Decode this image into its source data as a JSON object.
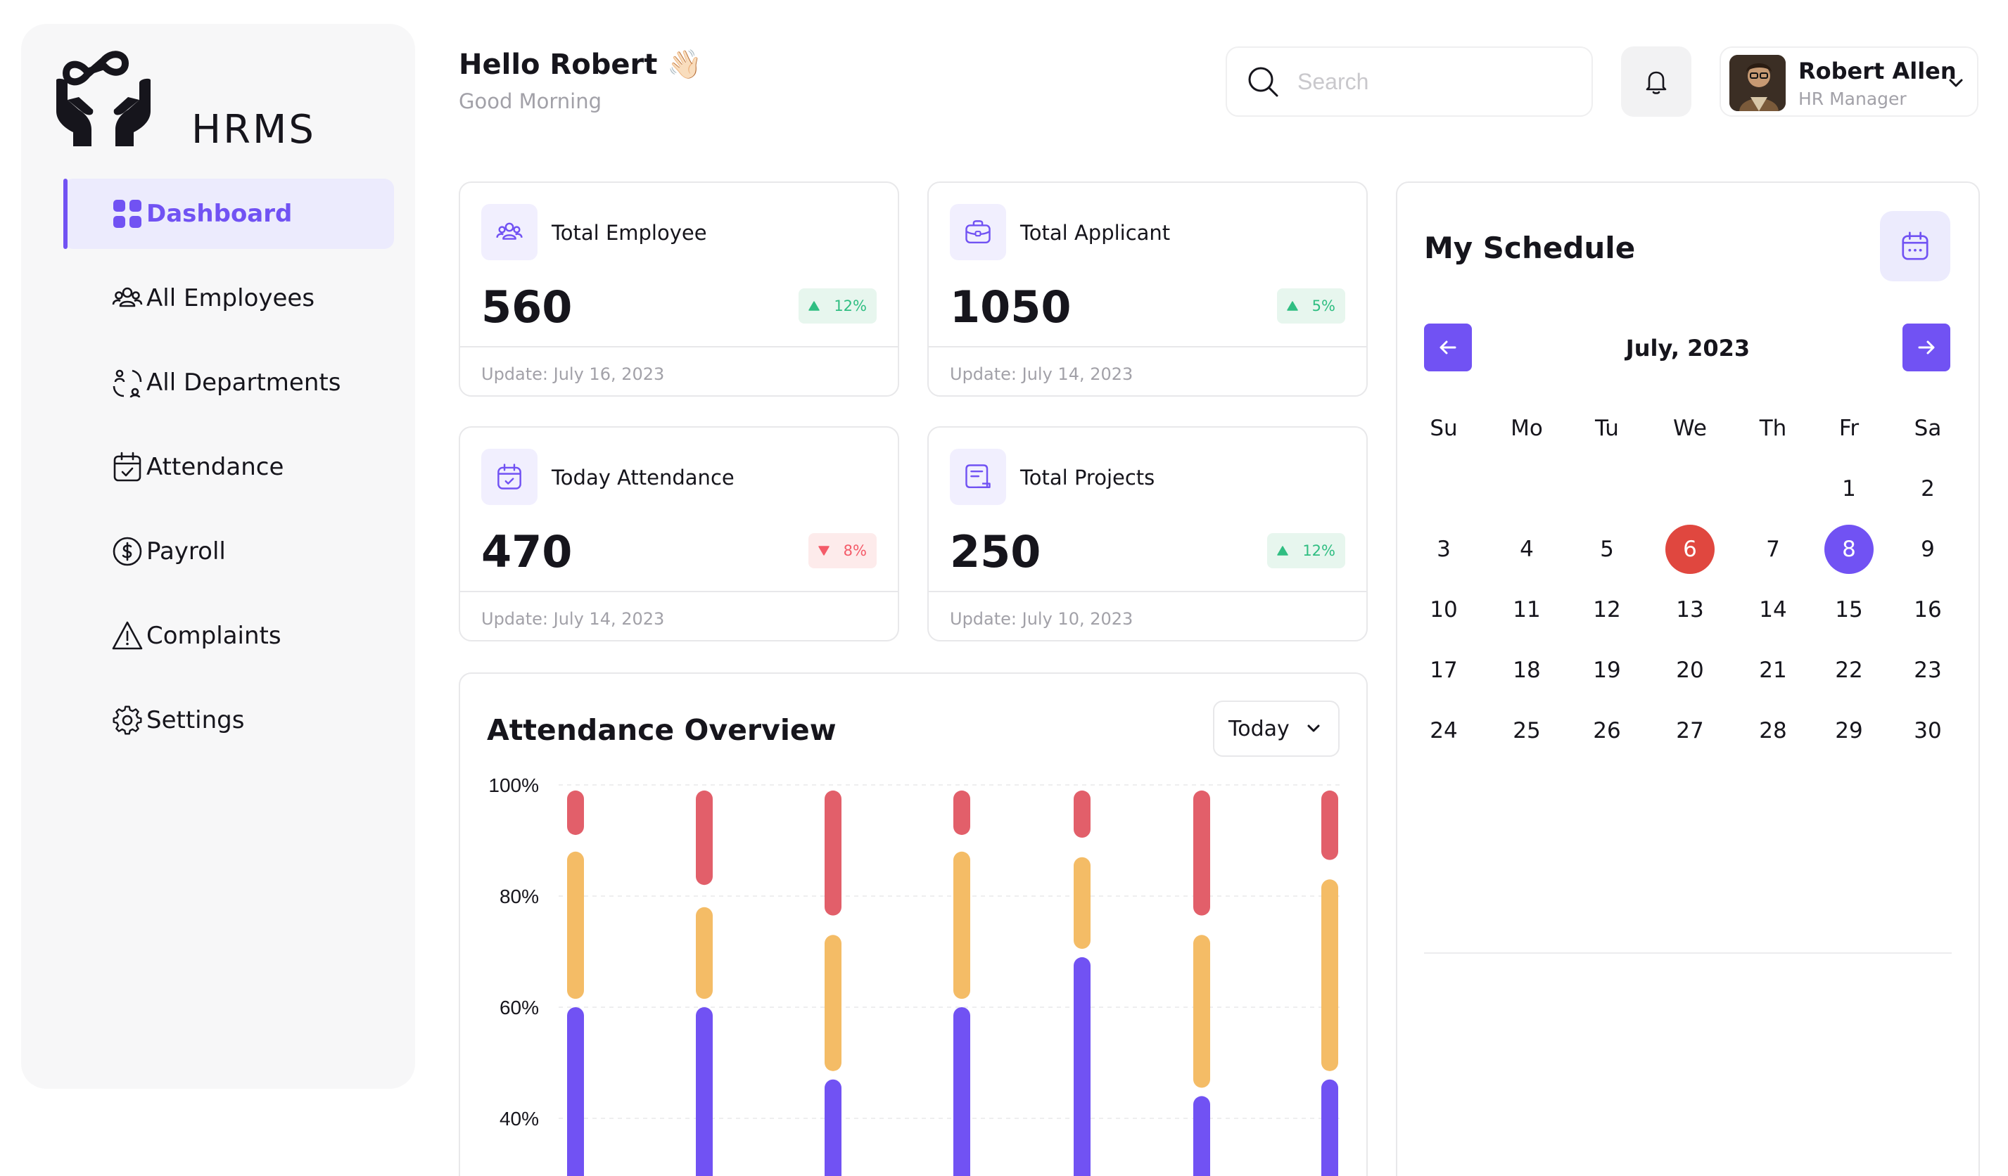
{
  "app": {
    "name": "HRMS"
  },
  "nav": {
    "items": [
      {
        "label": "Dashboard",
        "icon": "grid-icon",
        "active": true
      },
      {
        "label": "All Employees",
        "icon": "users-icon"
      },
      {
        "label": "All Departments",
        "icon": "departments-icon"
      },
      {
        "label": "Attendance",
        "icon": "calendar-check-icon"
      },
      {
        "label": "Payroll",
        "icon": "dollar-circle-icon"
      },
      {
        "label": "Complaints",
        "icon": "warning-icon"
      },
      {
        "label": "Settings",
        "icon": "gear-icon"
      }
    ]
  },
  "header": {
    "greeting": "Hello Robert 👋🏻",
    "subtitle": "Good Morning",
    "search_placeholder": "Search",
    "user": {
      "name": "Robert Allen",
      "role": "HR Manager"
    }
  },
  "stats": [
    {
      "title": "Total Employee",
      "value": "560",
      "change": "12%",
      "trend": "up",
      "update": "Update: July 16, 2023",
      "icon": "users-icon"
    },
    {
      "title": "Total Applicant",
      "value": "1050",
      "change": "5%",
      "trend": "up",
      "update": "Update: July 14, 2023",
      "icon": "briefcase-icon"
    },
    {
      "title": "Today Attendance",
      "value": "470",
      "change": "8%",
      "trend": "down",
      "update": "Update: July 14, 2023",
      "icon": "calendar-check-icon"
    },
    {
      "title": "Total Projects",
      "value": "250",
      "change": "12%",
      "trend": "up",
      "update": "Update: July 10, 2023",
      "icon": "document-icon"
    }
  ],
  "overview": {
    "title": "Attendance Overview",
    "period": "Today"
  },
  "chart_data": {
    "type": "bar",
    "stacked": true,
    "y_ticks": [
      "100%",
      "80%",
      "60%",
      "40%"
    ],
    "ylim": [
      30,
      100
    ],
    "categories": [
      "",
      "",
      "",
      "",
      "",
      "",
      ""
    ],
    "series": [
      {
        "color": "#7152f3",
        "values": [
          60,
          60,
          47,
          60,
          69,
          44,
          47
        ]
      },
      {
        "color": "#f4bc66",
        "values": [
          35,
          32,
          50,
          35,
          34,
          53,
          52
        ]
      },
      {
        "color": "#e25f6a",
        "values": [
          100,
          98,
          100,
          100,
          100,
          100,
          99
        ]
      }
    ],
    "segments": [
      {
        "on_time": 60,
        "late": [
          61.5,
          88
        ],
        "absent": [
          91,
          99
        ]
      },
      {
        "on_time": 60,
        "late": [
          61.5,
          78
        ],
        "absent": [
          82,
          99
        ]
      },
      {
        "on_time": 47,
        "late": [
          48.5,
          73
        ],
        "absent": [
          76.5,
          99
        ]
      },
      {
        "on_time": 60,
        "late": [
          61.5,
          88
        ],
        "absent": [
          91,
          99
        ]
      },
      {
        "on_time": 69,
        "late": [
          70.5,
          87
        ],
        "absent": [
          90.5,
          99
        ]
      },
      {
        "on_time": 44,
        "late": [
          45.5,
          73
        ],
        "absent": [
          76.5,
          99
        ]
      },
      {
        "on_time": 47,
        "late": [
          48.5,
          83
        ],
        "absent": [
          86.5,
          99
        ]
      }
    ]
  },
  "schedule": {
    "title": "My Schedule",
    "month": "July, 2023",
    "weekdays": [
      "Su",
      "Mo",
      "Tu",
      "We",
      "Th",
      "Fr",
      "Sa"
    ],
    "first_weekday_index": 5,
    "days_in_month": 30,
    "today": 6,
    "selected": 8,
    "colors": {
      "today": "#e0473f",
      "selected": "#7152f3"
    }
  }
}
